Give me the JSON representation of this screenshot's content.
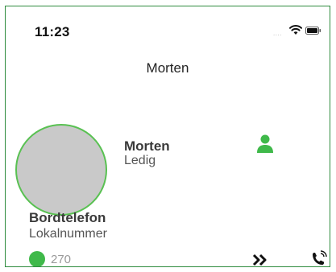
{
  "status_bar": {
    "time": "11:23",
    "signal": "....",
    "icons": [
      "wifi-icon",
      "battery-icon"
    ]
  },
  "nav": {
    "title": "Morten"
  },
  "contact": {
    "name": "Morten",
    "status": "Ledig",
    "presence_icon": "person-icon",
    "presence_color": "#3fb94a"
  },
  "phone_section": {
    "title": "Bordtelefon",
    "subtitle": "Lokalnummer",
    "status_color": "#3fb94a",
    "number": "270",
    "actions": [
      "forward-icon",
      "call-icon"
    ]
  },
  "colors": {
    "accent": "#3fb94a",
    "frame": "#2e8b3e"
  }
}
